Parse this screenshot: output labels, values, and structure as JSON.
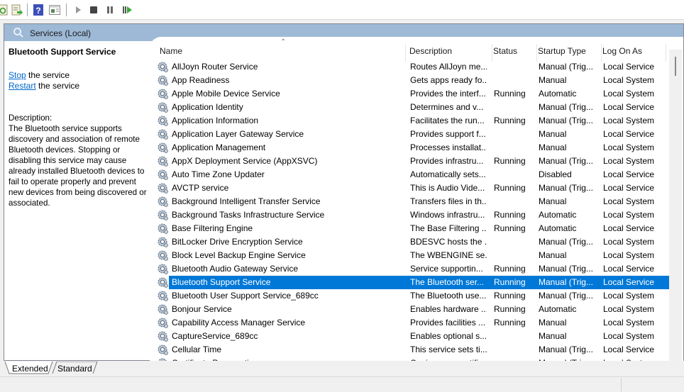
{
  "toolbar": {
    "buttons": [
      {
        "name": "refresh-icon"
      },
      {
        "name": "export-list-icon"
      },
      {
        "name": "help-icon"
      },
      {
        "name": "show-hide-action-pane-icon"
      },
      {
        "name": "start-service-icon"
      },
      {
        "name": "stop-service-icon"
      },
      {
        "name": "pause-service-icon"
      },
      {
        "name": "restart-service-icon"
      }
    ]
  },
  "header": {
    "title": "Services (Local)"
  },
  "details": {
    "service_name": "Bluetooth Support Service",
    "actions": [
      {
        "link": "Stop",
        "rest": " the service"
      },
      {
        "link": "Restart",
        "rest": " the service"
      }
    ],
    "description_label": "Description:",
    "description": "The Bluetooth service supports discovery and association of remote Bluetooth devices.  Stopping or disabling this service may cause already installed Bluetooth devices to fail to operate properly and prevent new devices from being discovered or associated."
  },
  "table": {
    "columns": [
      "Name",
      "Description",
      "Status",
      "Startup Type",
      "Log On As"
    ],
    "sort_column": "Name",
    "selected_index": 16,
    "rows": [
      [
        "AllJoyn Router Service",
        "Routes AllJoyn me...",
        "",
        "Manual (Trig...",
        "Local Service"
      ],
      [
        "App Readiness",
        "Gets apps ready fo...",
        "",
        "Manual",
        "Local System"
      ],
      [
        "Apple Mobile Device Service",
        "Provides the interf...",
        "Running",
        "Automatic",
        "Local System"
      ],
      [
        "Application Identity",
        "Determines and v...",
        "",
        "Manual (Trig...",
        "Local Service"
      ],
      [
        "Application Information",
        "Facilitates the run...",
        "Running",
        "Manual (Trig...",
        "Local System"
      ],
      [
        "Application Layer Gateway Service",
        "Provides support f...",
        "",
        "Manual",
        "Local Service"
      ],
      [
        "Application Management",
        "Processes installat...",
        "",
        "Manual",
        "Local System"
      ],
      [
        "AppX Deployment Service (AppXSVC)",
        "Provides infrastru...",
        "Running",
        "Manual (Trig...",
        "Local System"
      ],
      [
        "Auto Time Zone Updater",
        "Automatically sets...",
        "",
        "Disabled",
        "Local Service"
      ],
      [
        "AVCTP service",
        "This is Audio Vide...",
        "Running",
        "Manual (Trig...",
        "Local Service"
      ],
      [
        "Background Intelligent Transfer Service",
        "Transfers files in th...",
        "",
        "Manual",
        "Local System"
      ],
      [
        "Background Tasks Infrastructure Service",
        "Windows infrastru...",
        "Running",
        "Automatic",
        "Local System"
      ],
      [
        "Base Filtering Engine",
        "The Base Filtering ...",
        "Running",
        "Automatic",
        "Local Service"
      ],
      [
        "BitLocker Drive Encryption Service",
        "BDESVC hosts the ...",
        "",
        "Manual (Trig...",
        "Local System"
      ],
      [
        "Block Level Backup Engine Service",
        "The WBENGINE se...",
        "",
        "Manual",
        "Local System"
      ],
      [
        "Bluetooth Audio Gateway Service",
        "Service supportin...",
        "Running",
        "Manual (Trig...",
        "Local Service"
      ],
      [
        "Bluetooth Support Service",
        "The Bluetooth ser...",
        "Running",
        "Manual (Trig...",
        "Local Service"
      ],
      [
        "Bluetooth User Support Service_689cc",
        "The Bluetooth use...",
        "Running",
        "Manual (Trig...",
        "Local System"
      ],
      [
        "Bonjour Service",
        "Enables hardware ...",
        "Running",
        "Automatic",
        "Local System"
      ],
      [
        "Capability Access Manager Service",
        "Provides facilities ...",
        "Running",
        "Manual",
        "Local System"
      ],
      [
        "CaptureService_689cc",
        "Enables optional s...",
        "",
        "Manual",
        "Local System"
      ],
      [
        "Cellular Time",
        "This service sets ti...",
        "",
        "Manual (Trig...",
        "Local Service"
      ],
      [
        "Certificate Propagation",
        "Copies user certifi...",
        "",
        "Manual (Trig...",
        "Local System"
      ]
    ]
  },
  "tabs": [
    "Extended",
    "Standard"
  ],
  "active_tab": "Extended",
  "colors": {
    "selection": "#0078d7",
    "header_band": "#9db9d6",
    "link": "#0066cc"
  }
}
